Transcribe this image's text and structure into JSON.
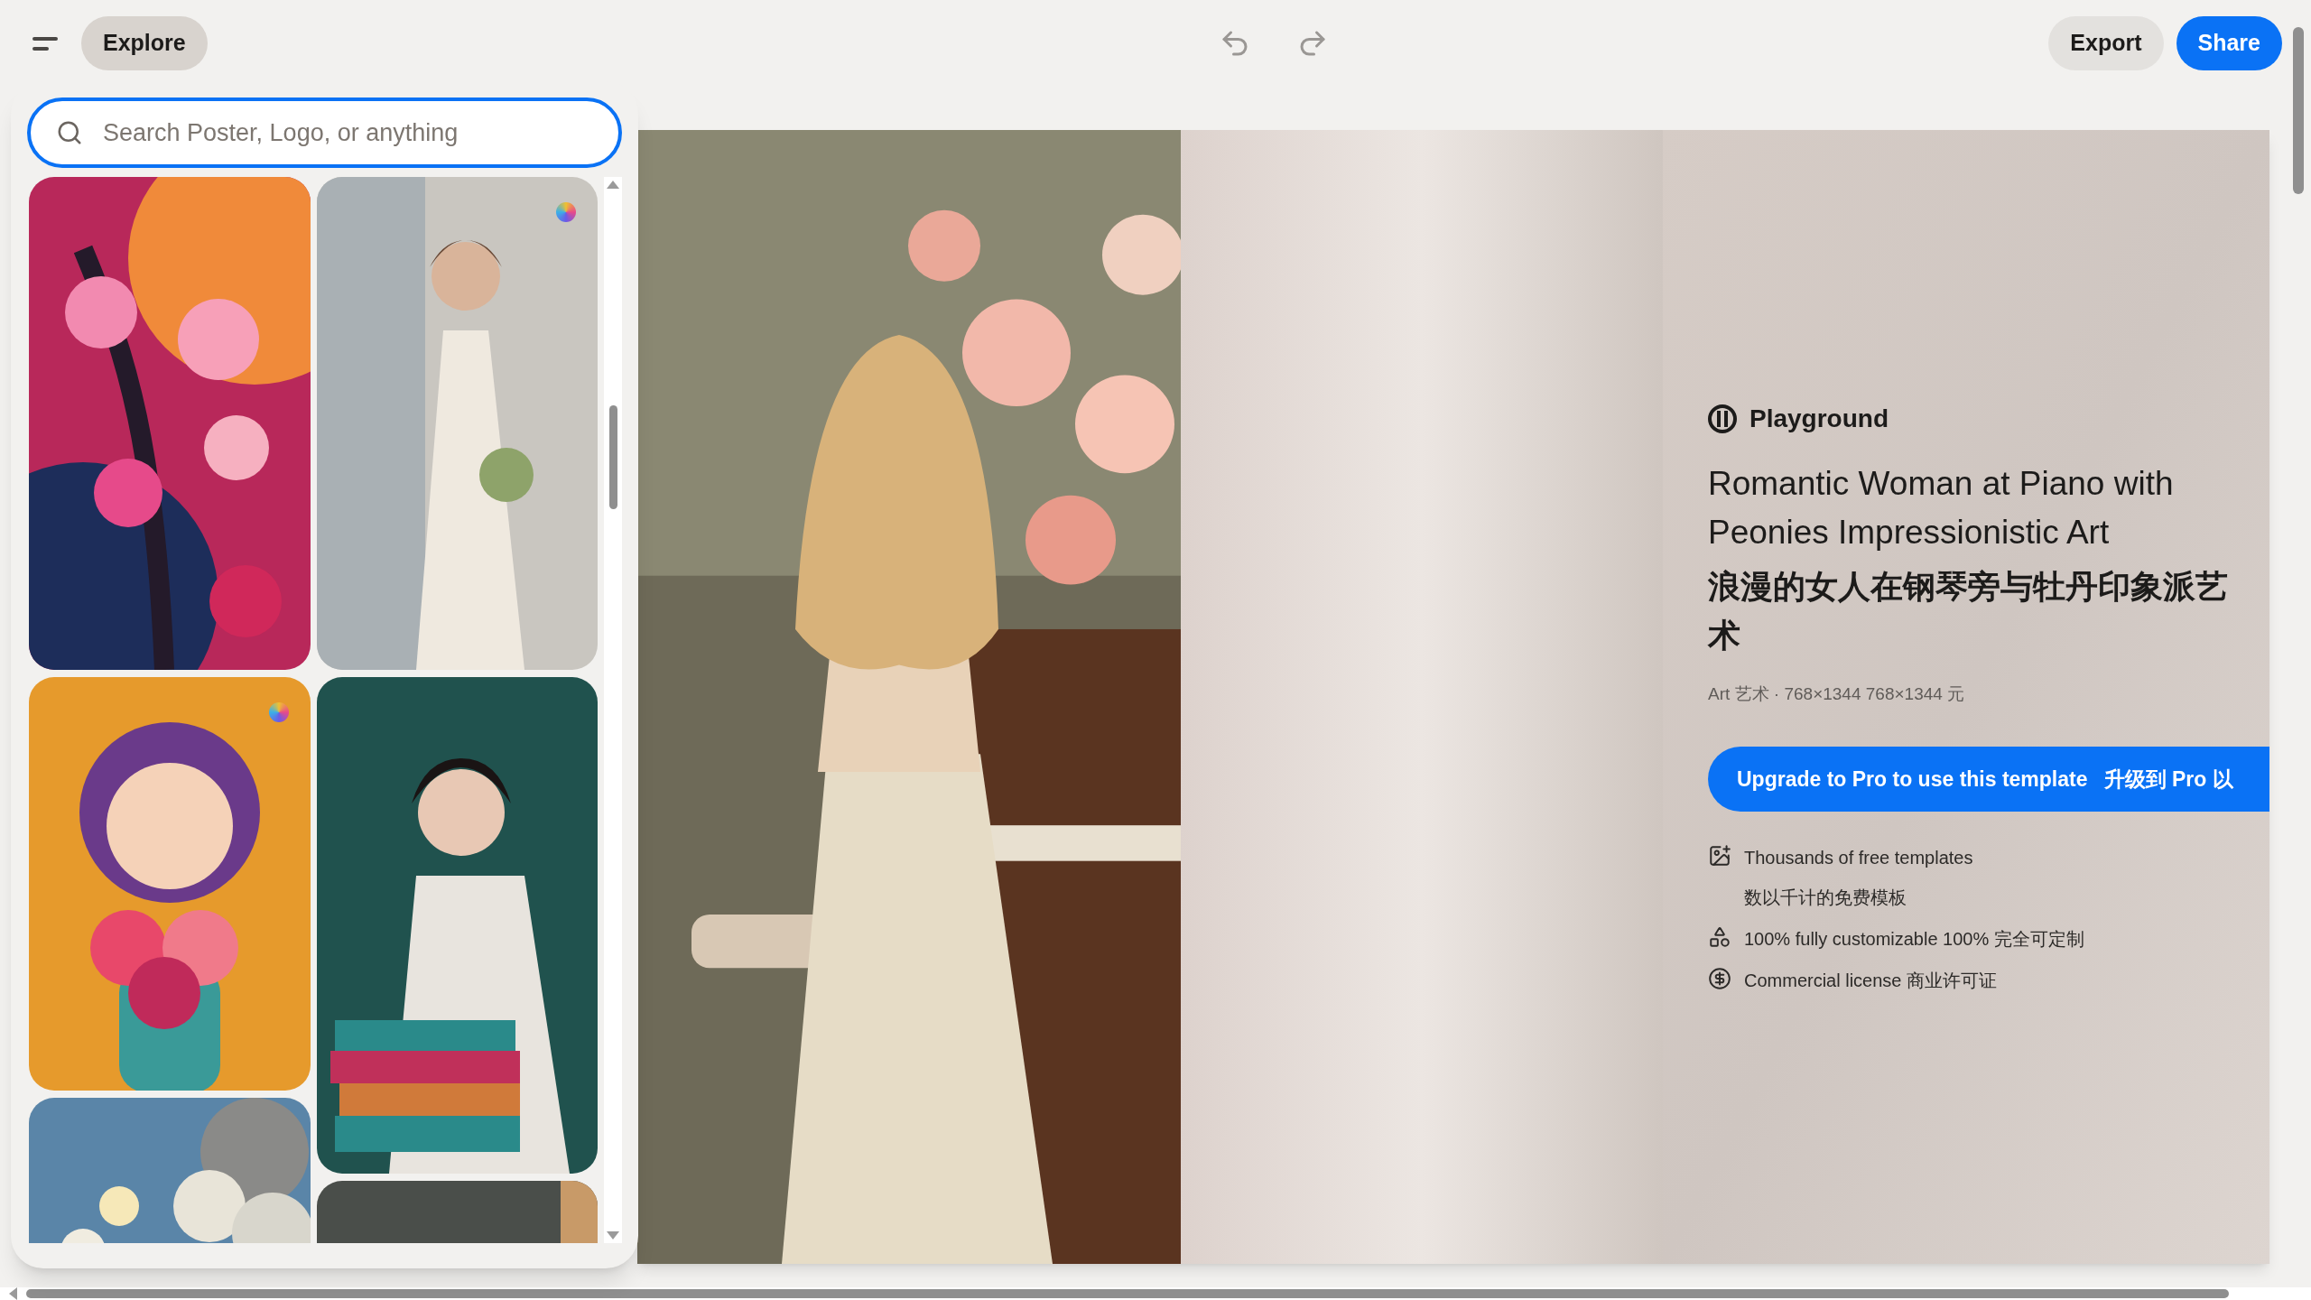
{
  "toolbar": {
    "explore": "Explore",
    "export": "Export",
    "share": "Share"
  },
  "search": {
    "placeholder": "Search Poster, Logo, or anything"
  },
  "templates": [
    {
      "kind": "picture",
      "premium": false
    },
    {
      "kind": "picture",
      "premium": true
    },
    {
      "kind": "picture",
      "premium": true
    },
    {
      "kind": "picture",
      "premium": false
    },
    {
      "kind": "picture",
      "premium": false
    },
    {
      "kind": "picture",
      "premium": false
    }
  ],
  "canvas": {
    "picture": {
      "kind": "picture"
    }
  },
  "details": {
    "brand": "Playground",
    "title_en": "Romantic Woman at Piano with Peonies Impressionistic Art",
    "title_zh": "浪漫的女人在钢琴旁与牡丹印象派艺术",
    "meta": "Art 艺术 · 768×1344 768×1344 元",
    "upgrade": {
      "label": "Upgrade to Pro to use this template",
      "label_zh": "升级到 Pro 以"
    },
    "features": [
      {
        "kind": "templates",
        "lines": [
          "Thousands of free templates",
          "数以千计的免费模板"
        ]
      },
      {
        "kind": "customize",
        "lines": [
          "100% fully customizable 100% 完全可定制"
        ]
      },
      {
        "kind": "license",
        "lines": [
          "Commercial license 商业许可证"
        ]
      }
    ]
  }
}
